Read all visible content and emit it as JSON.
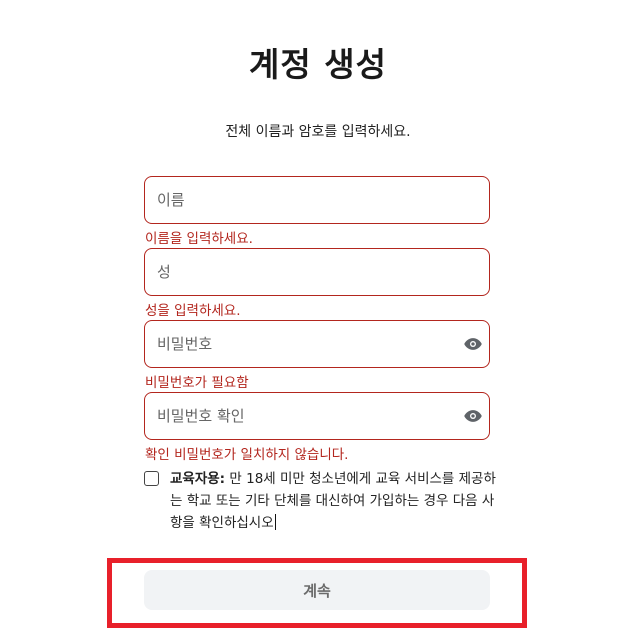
{
  "header": {
    "title": "계정 생성",
    "subtitle": "전체 이름과 암호를 입력하세요."
  },
  "form": {
    "first_name": {
      "placeholder": "이름",
      "value": "",
      "error": "이름을 입력하세요."
    },
    "last_name": {
      "placeholder": "성",
      "value": "",
      "error": "성을 입력하세요."
    },
    "password": {
      "placeholder": "비밀번호",
      "value": "",
      "error": "비밀번호가 필요함",
      "toggle_icon": "eye-icon"
    },
    "confirm_password": {
      "placeholder": "비밀번호 확인",
      "value": "",
      "error": "확인 비밀번호가 일치하지 않습니다.",
      "toggle_icon": "eye-icon"
    },
    "education": {
      "checked": false,
      "label_bold": "교육자용:",
      "label_text": "만 18세 미만 청소년에게 교육 서비스를 제공하는 학교 또는 기타 단체를 대신하여 가입하는 경우 다음 사항을 확인하십시오"
    },
    "continue_label": "계속"
  },
  "colors": {
    "error": "#b3261e",
    "highlight_box": "#e8202a",
    "button_bg": "#f1f3f5",
    "button_text": "#6b6b6b"
  }
}
